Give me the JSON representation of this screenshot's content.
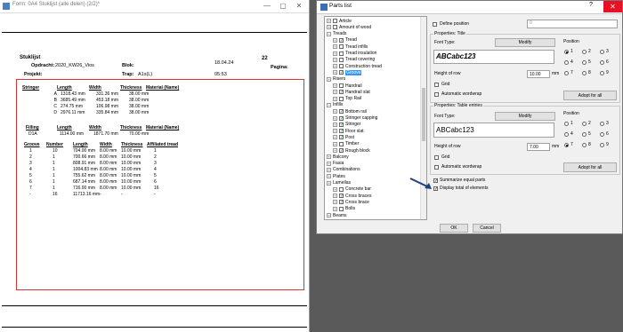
{
  "background_window": {
    "title": "Form: 0A4 Stuklijst (alle delen) (2/2)*",
    "controls": [
      "—",
      "▢",
      "✕"
    ],
    "report": {
      "stuklijst": "Stuklijst",
      "opdracht_label": "Opdracht:",
      "opdracht_value": "2020_KW26_Vios",
      "projekt_label": "Projekt:",
      "blok_label": "Blok:",
      "trap_label": "Trap:",
      "trap_value": "A1s(L)",
      "date": "18.04.24",
      "time": "05:53",
      "number": "22",
      "pagina": "Pagina:"
    },
    "stringer": {
      "headers": [
        "Stringer",
        "Length",
        "Width",
        "Thickness",
        "Material (Name)"
      ],
      "rows": [
        [
          "A",
          "1318.43 mm",
          "331.36 mm",
          "38.00 mm",
          ""
        ],
        [
          "B",
          "3685.49 mm",
          "453.18 mm",
          "38.00 mm",
          ""
        ],
        [
          "C",
          "274.75 mm",
          "106.98 mm",
          "38.00 mm",
          ""
        ],
        [
          "D",
          "2976.11 mm",
          "335.84 mm",
          "38.00 mm",
          ""
        ]
      ]
    },
    "filling": {
      "headers": [
        "Filling",
        "Length",
        "Width",
        "Thickness",
        "Material (Name)"
      ],
      "rows": [
        [
          "D1A",
          "1114.00 mm",
          "1871.70 mm",
          "70.00 mm",
          ""
        ]
      ]
    },
    "groove": {
      "headers": [
        "Groove",
        "Number",
        "Length",
        "Width",
        "Thickness",
        "Affiliated tread"
      ],
      "rows": [
        [
          "1",
          "10",
          "704.00 mm",
          "8.00 mm",
          "10.00 mm",
          "1"
        ],
        [
          "2",
          "1",
          "700.66 mm",
          "8.00 mm",
          "10.00 mm",
          "2"
        ],
        [
          "3",
          "1",
          "808.91 mm",
          "8.00 mm",
          "10.00 mm",
          "3"
        ],
        [
          "4",
          "1",
          "1004.83 mm",
          "8.00 mm",
          "10.00 mm",
          "4"
        ],
        [
          "5",
          "1",
          "755.62 mm",
          "8.00 mm",
          "10.00 mm",
          "5"
        ],
        [
          "6",
          "1",
          "687.14 mm",
          "8.00 mm",
          "10.00 mm",
          "6"
        ],
        [
          "7",
          "1",
          "716.00 mm",
          "8.00 mm",
          "10.00 mm",
          "16"
        ],
        [
          "-",
          "16",
          "11713.16 mm",
          "-",
          "-",
          "-"
        ]
      ]
    }
  },
  "dialog": {
    "title": "Parts list",
    "help": "?",
    "close": "✕",
    "tree": [
      {
        "label": "Article",
        "level": 0,
        "exp": "+",
        "check": "",
        "sel": false
      },
      {
        "label": "Amount of wood",
        "level": 0,
        "exp": "+",
        "check": "",
        "sel": false
      },
      {
        "label": "Treads",
        "level": 0,
        "exp": "−",
        "check": null,
        "sel": false
      },
      {
        "label": "Tread",
        "level": 1,
        "exp": "+",
        "check": "✓",
        "sel": false
      },
      {
        "label": "Tread infills",
        "level": 1,
        "exp": "+",
        "check": "",
        "sel": false
      },
      {
        "label": "Tread insulation",
        "level": 1,
        "exp": "+",
        "check": "",
        "sel": false
      },
      {
        "label": "Tread covering",
        "level": 1,
        "exp": "+",
        "check": "",
        "sel": false
      },
      {
        "label": "Construction tread",
        "level": 1,
        "exp": "+",
        "check": "",
        "sel": false
      },
      {
        "label": "Groove",
        "level": 1,
        "exp": "+",
        "check": "✓",
        "sel": true
      },
      {
        "label": "Risers",
        "level": 0,
        "exp": "+",
        "check": null,
        "sel": false
      },
      {
        "label": "Handrail",
        "level": 1,
        "exp": "+",
        "check": "",
        "sel": false
      },
      {
        "label": "Handrail slat",
        "level": 1,
        "exp": "+",
        "check": "✓",
        "sel": false
      },
      {
        "label": "Top Rail",
        "level": 1,
        "exp": "+",
        "check": "",
        "sel": false
      },
      {
        "label": "Infills",
        "level": 0,
        "exp": "−",
        "check": null,
        "sel": false
      },
      {
        "label": "Bottom rail",
        "level": 1,
        "exp": "+",
        "check": "✓",
        "sel": false
      },
      {
        "label": "Stringer capping",
        "level": 1,
        "exp": "+",
        "check": "✓",
        "sel": false
      },
      {
        "label": "Stringer",
        "level": 1,
        "exp": "+",
        "check": "✓",
        "sel": false
      },
      {
        "label": "Floor slat",
        "level": 1,
        "exp": "+",
        "check": "✓",
        "sel": false
      },
      {
        "label": "Post",
        "level": 1,
        "exp": "+",
        "check": "✓",
        "sel": false
      },
      {
        "label": "Timber",
        "level": 1,
        "exp": "+",
        "check": "",
        "sel": false
      },
      {
        "label": "Rough block",
        "level": 1,
        "exp": "+",
        "check": "✓",
        "sel": false
      },
      {
        "label": "Balcony",
        "level": 0,
        "exp": "+",
        "check": null,
        "sel": false
      },
      {
        "label": "Fasia",
        "level": 0,
        "exp": "+",
        "check": null,
        "sel": false
      },
      {
        "label": "Combinations",
        "level": 0,
        "exp": "+",
        "check": null,
        "sel": false
      },
      {
        "label": "Plates",
        "level": 0,
        "exp": "+",
        "check": null,
        "sel": false
      },
      {
        "label": "Lamellas",
        "level": 0,
        "exp": "+",
        "check": null,
        "sel": false
      },
      {
        "label": "Concrete bar",
        "level": 1,
        "exp": "+",
        "check": "",
        "sel": false
      },
      {
        "label": "Cross braces",
        "level": 1,
        "exp": "+",
        "check": "✓",
        "sel": false
      },
      {
        "label": "Cross brace",
        "level": 1,
        "exp": "+",
        "check": "✓",
        "sel": false
      },
      {
        "label": "Bolts",
        "level": 1,
        "exp": "+",
        "check": "",
        "sel": false
      },
      {
        "label": "Beams",
        "level": 0,
        "exp": "+",
        "check": null,
        "sel": false
      }
    ],
    "define_position": "Define position",
    "define_position_value": "0",
    "title_group": {
      "label": "Properties: Title",
      "font_type": "Font Type:",
      "modify": "Modify",
      "preview": "ABCabc123",
      "height_of_row": "Height of row",
      "height_value": "10.00",
      "unit": "mm",
      "grid": "Grid",
      "wordwrap": "Automatic wordwrap",
      "position_label": "Position",
      "positions": [
        "1",
        "2",
        "3",
        "4",
        "5",
        "6",
        "7",
        "8",
        "9"
      ],
      "selected_position": "1",
      "adopt": "Adopt for all"
    },
    "entries_group": {
      "label": "Properties: Table entries",
      "font_type": "Font Type:",
      "modify": "Modify",
      "preview": "ABCabc123",
      "height_of_row": "Height of row",
      "height_value": "7.00",
      "unit": "mm",
      "grid": "Grid",
      "wordwrap": "Automatic wordwrap",
      "position_label": "Position",
      "positions": [
        "1",
        "2",
        "3",
        "4",
        "5",
        "6",
        "7",
        "8",
        "9"
      ],
      "selected_position": "7",
      "adopt": "Adopt for all"
    },
    "summarize": "Summarize equal parts",
    "display_total": "Display total of elements",
    "ok": "OK",
    "cancel": "Cancel",
    "colors": {
      "accent": "#3399ff",
      "close": "#e81123",
      "arrow": "#1f3f7a"
    }
  }
}
